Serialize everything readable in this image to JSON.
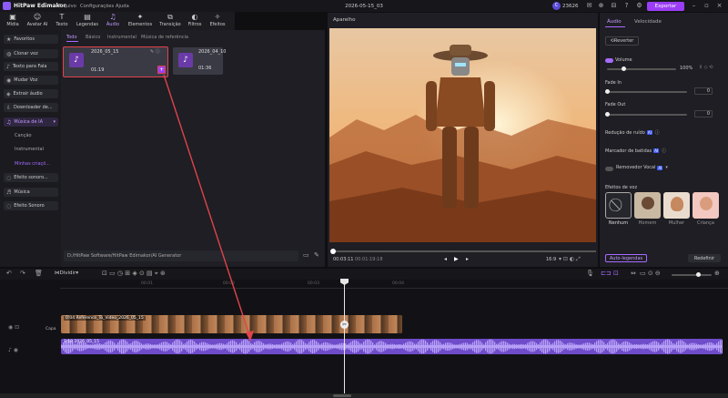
{
  "app": {
    "name": "HitPaw Edimakor",
    "menus": [
      "Arquivo",
      "Configurações",
      "Ajuda"
    ],
    "project_title": "2026-05-15_03",
    "credits": "23626",
    "export_label": "Exportar"
  },
  "toolbar": {
    "items": [
      {
        "label": "Mídia",
        "icon": "media-icon",
        "glyph": "▣"
      },
      {
        "label": "Avatar AI",
        "icon": "avatar-icon",
        "glyph": "☺"
      },
      {
        "label": "Texto",
        "icon": "text-icon",
        "glyph": "T"
      },
      {
        "label": "Legendas",
        "icon": "subtitles-icon",
        "glyph": "▤"
      },
      {
        "label": "Áudio",
        "icon": "music-icon",
        "glyph": "♫"
      },
      {
        "label": "Elementos",
        "icon": "elements-icon",
        "glyph": "✦"
      },
      {
        "label": "Transição",
        "icon": "transition-icon",
        "glyph": "⧉"
      },
      {
        "label": "Filtros",
        "icon": "filter-icon",
        "glyph": "◐"
      },
      {
        "label": "Efeitos",
        "icon": "effects-icon",
        "glyph": "✧"
      }
    ]
  },
  "left_panel": {
    "items": [
      {
        "label": "Favoritos",
        "glyph": "★"
      },
      {
        "label": "Clonar voz",
        "glyph": "◍"
      },
      {
        "label": "Texto para Fala",
        "glyph": "♪"
      },
      {
        "label": "Mudar Voz",
        "glyph": "◉"
      },
      {
        "label": "Extrair áudio",
        "glyph": "◈"
      },
      {
        "label": "Downloader de...",
        "glyph": "⇩"
      },
      {
        "label": "Música de IA",
        "glyph": "♫"
      }
    ],
    "subitems": [
      "Canção",
      "Instrumental",
      "Minhas criaçõ..."
    ],
    "items2": [
      {
        "label": "Efeito sonoro...",
        "glyph": "◌"
      },
      {
        "label": "Música",
        "glyph": "♬"
      },
      {
        "label": "Efeito Sonoro",
        "glyph": "◌"
      }
    ]
  },
  "media": {
    "tabs": [
      "Todo",
      "Básico",
      "Instrumental",
      "Música de referência"
    ],
    "cards": [
      {
        "name": "2026_05_15",
        "duration": "01:19"
      },
      {
        "name": "2026_04_10",
        "duration": "01:36"
      }
    ],
    "path": "D:/HitPaw Software/HitPaw Edimakor/AI Generator"
  },
  "player": {
    "title": "Aparelho",
    "current": "00:03:11",
    "total": "00:01:19:18",
    "ratio": "16:9"
  },
  "right_panel": {
    "tabs": [
      "Áudio",
      "Velocidade"
    ],
    "reset_label": "Reverter",
    "volume_label": "Volume",
    "volume_value": "100%",
    "volume_level": 1.0,
    "fade_in_label": "Fade In",
    "fade_in_value": "0",
    "fade_out_label": "Fade Out",
    "fade_out_value": "0",
    "noise_label": "Redução de ruído",
    "ai_badge": "AI",
    "beat_label": "Marcador de batidas",
    "vocal_label": "Removedor Vocal",
    "voice_effects_label": "Efeitos de voz",
    "voices": [
      "Nenhum",
      "Homem",
      "Mulher",
      "Criança"
    ],
    "auto_subtitles": "Auto-legendas",
    "redefine": "Redefinir"
  },
  "timeline": {
    "split_label": "Dividir",
    "ruler": [
      "00:00",
      "00:01",
      "00:02",
      "00:03",
      "00:04"
    ],
    "track_label": "Capa",
    "video_clip": "0:04 Reference_To_Video_2026_05_15",
    "audio_clip": "1:19 2026_05_15"
  },
  "colors": {
    "accent": "#9b3df5",
    "annotation": "#e0434a"
  }
}
